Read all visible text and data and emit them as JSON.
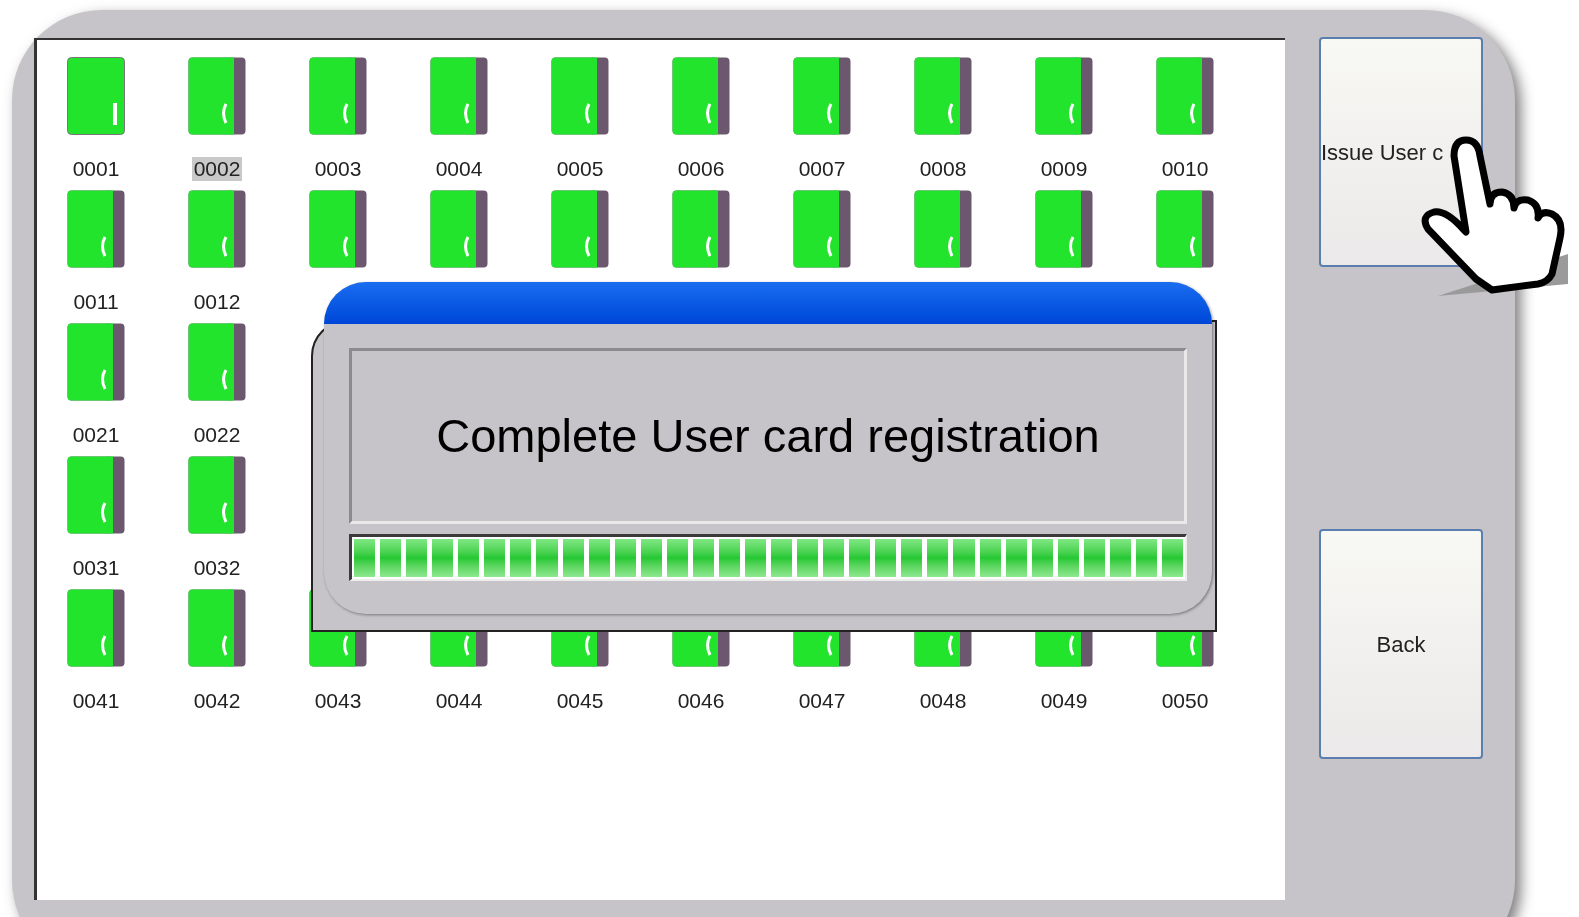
{
  "card_grid": [
    {
      "cards": [
        {
          "kind": "front",
          "label": "0001",
          "selected": false
        },
        {
          "kind": "side",
          "label": "0002",
          "selected": true
        },
        {
          "kind": "side",
          "label": "0003",
          "selected": false
        },
        {
          "kind": "side",
          "label": "0004",
          "selected": false
        },
        {
          "kind": "side",
          "label": "0005",
          "selected": false
        },
        {
          "kind": "side",
          "label": "0006",
          "selected": false
        },
        {
          "kind": "side",
          "label": "0007",
          "selected": false
        },
        {
          "kind": "side",
          "label": "0008",
          "selected": false
        },
        {
          "kind": "side",
          "label": "0009",
          "selected": false
        },
        {
          "kind": "side",
          "label": "0010",
          "selected": false
        }
      ]
    },
    {
      "cards": [
        {
          "kind": "side",
          "label": "0011",
          "selected": false
        },
        {
          "kind": "side",
          "label": "0012",
          "selected": false
        },
        {
          "kind": "side"
        },
        {
          "kind": "side"
        },
        {
          "kind": "side"
        },
        {
          "kind": "side"
        },
        {
          "kind": "side"
        },
        {
          "kind": "side"
        },
        {
          "kind": "side"
        },
        {
          "kind": "side"
        }
      ]
    },
    {
      "cards": [
        {
          "kind": "side",
          "label": "0021",
          "selected": false
        },
        {
          "kind": "side",
          "label": "0022",
          "selected": false
        },
        {
          "kind": "covered"
        },
        {
          "kind": "covered"
        },
        {
          "kind": "covered"
        },
        {
          "kind": "covered"
        },
        {
          "kind": "covered"
        },
        {
          "kind": "covered"
        },
        {
          "kind": "covered"
        },
        {
          "kind": "covered"
        }
      ]
    },
    {
      "cards": [
        {
          "kind": "side",
          "label": "0031",
          "selected": false
        },
        {
          "kind": "side",
          "label": "0032",
          "selected": false
        },
        {
          "kind": "covered"
        },
        {
          "kind": "covered"
        },
        {
          "kind": "covered"
        },
        {
          "kind": "covered"
        },
        {
          "kind": "covered"
        },
        {
          "kind": "covered"
        },
        {
          "kind": "covered"
        },
        {
          "kind": "covered"
        }
      ]
    },
    {
      "cards": [
        {
          "kind": "side",
          "label": "0041",
          "selected": false
        },
        {
          "kind": "side",
          "label": "0042",
          "selected": false
        },
        {
          "kind": "side",
          "label": "0043",
          "selected": false
        },
        {
          "kind": "side",
          "label": "0044",
          "selected": false
        },
        {
          "kind": "side",
          "label": "0045",
          "selected": false
        },
        {
          "kind": "side",
          "label": "0046",
          "selected": false
        },
        {
          "kind": "side",
          "label": "0047",
          "selected": false
        },
        {
          "kind": "side",
          "label": "0048",
          "selected": false
        },
        {
          "kind": "side",
          "label": "0049",
          "selected": false
        },
        {
          "kind": "side",
          "label": "0050",
          "selected": false
        }
      ]
    }
  ],
  "dialog": {
    "message": "Complete User card registration",
    "progress": {
      "level": 1
    }
  },
  "buttons": [
    "Issue User c",
    "Back"
  ]
}
